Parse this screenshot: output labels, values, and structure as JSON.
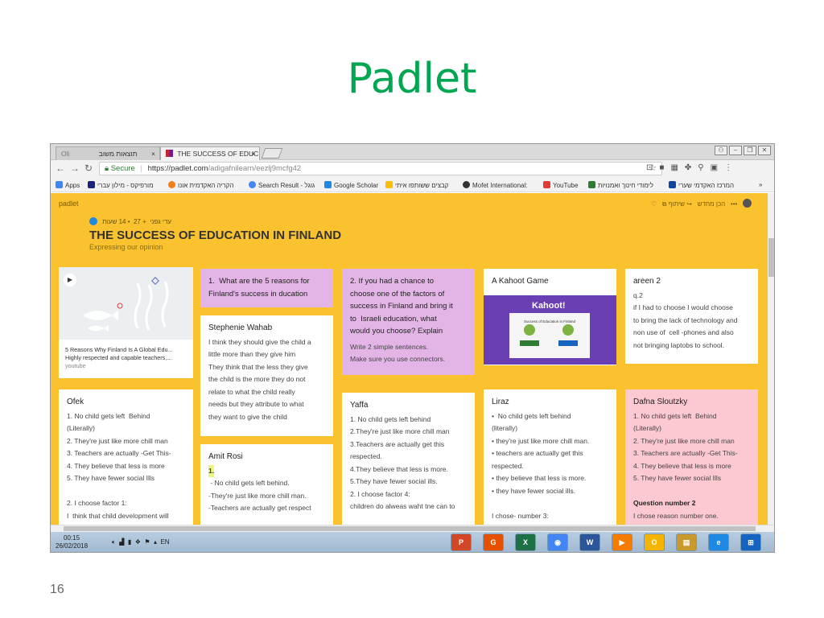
{
  "slide": {
    "title": "Padlet",
    "page_number": "16"
  },
  "browser": {
    "tabs": [
      {
        "label": "תוצאות משוב",
        "close": "×"
      },
      {
        "label": "THE SUCCESS OF EDUC",
        "close": "×"
      }
    ],
    "window_prefix": "Oli",
    "url": {
      "secure_label": "Secure",
      "host": "https://padlet.com",
      "path": "/adigafnilearn/eezlj9mcfg42"
    },
    "bookmarks": [
      {
        "label": "Apps",
        "color": "#4285f4"
      },
      {
        "label": "מורפיקס - מילון עברי",
        "color": "#1a237e"
      },
      {
        "label": "הקריה האקדמית אונו",
        "color": "#f57f17"
      },
      {
        "label": "Search Result - גוגל",
        "color": "#4285f4"
      },
      {
        "label": "Google Scholar",
        "color": "#1e88e5"
      },
      {
        "label": "קבצים ששותפו איתי",
        "color": "#fbbc04"
      },
      {
        "label": "Mofet International:",
        "color": "#333333"
      },
      {
        "label": "YouTube",
        "color": "#e53935"
      },
      {
        "label": "לימודי חינוך ואמנויות",
        "color": "#2e7d32"
      },
      {
        "label": "המרכז האקדמי שערי",
        "color": "#0d47a1"
      },
      {
        "label": "»",
        "color": ""
      }
    ]
  },
  "padlet": {
    "logo": "padlet",
    "toolbar": {
      "share": "שיתוף",
      "remake": "הכן מחדש",
      "more": "•••"
    },
    "meta": {
      "author": "עדי גפני",
      "likes": "+ 27",
      "age": "14 שעות"
    },
    "title": "THE SUCCESS OF EDUCATION IN FINLAND",
    "subtitle": "Expressing our opinion",
    "video": {
      "title": "5 Reasons Why Finland Is A Global Edu...",
      "desc": "Highly respected and capable teachers,...",
      "source": "youtube"
    },
    "cards": [
      {
        "id": "q1",
        "lines": [
          "1.  What are the 5 reasons for",
          "Finland's success in ducation"
        ]
      },
      {
        "id": "stephenie",
        "header": "Stephenie Wahab",
        "lines": [
          "I think they should give the child a",
          "little more than they give him",
          "They think that the less they give",
          "the child is the more they do not",
          "relate to what the child really",
          "needs but they attribute to what",
          "they want to give the child"
        ]
      },
      {
        "id": "amit",
        "header": "Amit Rosi",
        "lines": [
          "1.",
          " - No child gets left behind.",
          "-They're just like more chill man.",
          "-Teachers are actually get respect"
        ]
      },
      {
        "id": "q2",
        "lines": [
          "2. If you had a chance to",
          "choose one of the factors of",
          "success in Finland and bring it",
          "to  Israeli education, what",
          "would you choose? Explain",
          "Write 2 simple sentences.",
          "Make sure you use connectors."
        ]
      },
      {
        "id": "yaffa",
        "header": "Yaffa",
        "lines": [
          "1. No child gets left behind",
          "2.They're just like more chill man",
          "3.Teachers are actually get this",
          "respected.",
          "4.They believe that less is more.",
          "5.They have fewer social ills.",
          "2. I choose factor 4:",
          "children do alweas waht tne can to"
        ]
      },
      {
        "id": "kahoot",
        "header": "A Kahoot Game",
        "image_title": "Kahoot!",
        "image_caption": "Success of Education in Finland"
      },
      {
        "id": "liraz",
        "header": "Liraz",
        "lines": [
          "•  No child gets left behind",
          "(literally)",
          "• they're just like more chill man.",
          "• teachers are actually get this",
          "respected.",
          "• they believe that less is more.",
          "• they have fewer social ills.",
          "",
          "I chose- number 3:"
        ]
      },
      {
        "id": "areen",
        "header": "areen 2",
        "lines": [
          "q.2",
          "if I had to choose I would choose",
          "to bring the lack of technology and",
          "non use of  cell -phones and also",
          "not bringing laptobs to school."
        ]
      },
      {
        "id": "dafna",
        "header": "Dafna Sloutzky",
        "lines": [
          "1. No child gets left  Behind",
          "(Literally)",
          "2. They're just like more chill man",
          "3. Teachers are actually -Get This-",
          "4. They believe that less is more",
          "5. They have fewer social Ills",
          "",
          "Question number 2",
          "I chose reason number one."
        ]
      },
      {
        "id": "ofek",
        "header": "Ofek",
        "lines": [
          "1. No child gets left  Behind",
          "(Literally)",
          "2. They're just like more chill man",
          "3. Teachers are actually -Get This-",
          "4. They believe that less is more",
          "5. They have fewer social Ills",
          "",
          "2. I choose factor 1:",
          "I  think that child development will"
        ]
      }
    ],
    "add_button": "+"
  },
  "taskbar": {
    "time": "00:15",
    "date": "26/02/2018",
    "lang": "EN",
    "apps": [
      {
        "label": "P",
        "color": "#d24726"
      },
      {
        "label": "G",
        "color": "#e65100"
      },
      {
        "label": "X",
        "color": "#1e7145"
      },
      {
        "label": "◉",
        "color": "#4285f4"
      },
      {
        "label": "W",
        "color": "#2b579a"
      },
      {
        "label": "▶",
        "color": "#f57c00"
      },
      {
        "label": "O",
        "color": "#f4b400"
      },
      {
        "label": "▤",
        "color": "#c79a2b"
      },
      {
        "label": "e",
        "color": "#1e88e5"
      },
      {
        "label": "⊞",
        "color": "#1565c0"
      }
    ]
  }
}
